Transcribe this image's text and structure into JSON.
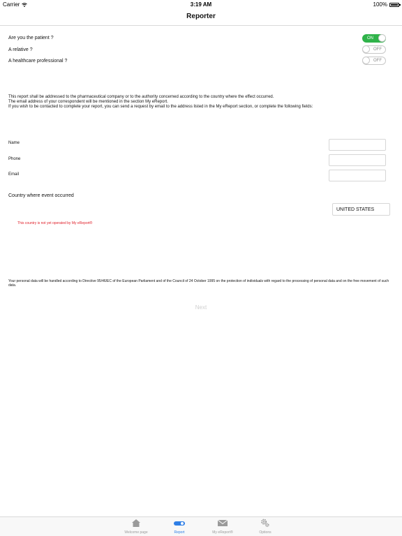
{
  "status_bar": {
    "carrier": "Carrier",
    "time": "3:19 AM",
    "battery": "100%"
  },
  "nav": {
    "title": "Reporter"
  },
  "questions": [
    {
      "label": "Are you the patient ?",
      "state": "ON"
    },
    {
      "label": "A relative ?",
      "state": "OFF"
    },
    {
      "label": "A healthcare professional ?",
      "state": "OFF"
    }
  ],
  "info": {
    "line1": "This report shall be addressed to the pharmaceutical company or to the authority concerned according to the country where the effect occurred.",
    "line2": "The email address of your correspondent will be mentioned in the section My eReport.",
    "line3": "If you wish to be contacted to complete your report, you can send a request by email to the address listed in the My eReport section, or complete the following fields:"
  },
  "fields": {
    "name_label": "Name",
    "name_value": "",
    "phone_label": "Phone",
    "phone_value": "",
    "email_label": "Email",
    "email_value": ""
  },
  "country": {
    "label": "Country where event occurred",
    "value": "UNITED STATES",
    "warning": "This country is not yet operated by My eReport®"
  },
  "privacy": "Your personal data will be handled according to Directive 95/46/EC of the European Parliament and of the Council of 24 October 1995 on the protection of individuals with regard to the processing of personal data and on the free movement of such data.",
  "next_label": "Next",
  "tabs": [
    {
      "label": "Welcome page",
      "icon": "home-icon"
    },
    {
      "label": "Report",
      "icon": "toggle-icon",
      "active": true
    },
    {
      "label": "My eReport®",
      "icon": "envelope-icon"
    },
    {
      "label": "Options",
      "icon": "gears-icon"
    }
  ],
  "colors": {
    "toggle_on": "#2fb34a",
    "active_tab": "#2f7fe6",
    "warning": "#e0202a"
  }
}
